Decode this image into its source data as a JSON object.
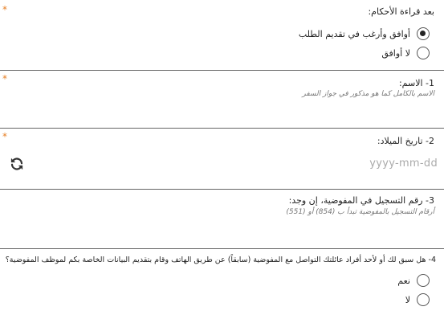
{
  "consent": {
    "question": "بعد قراءة الأحكام:",
    "options": [
      {
        "label": "أوافق وأرغب في تقديم الطلب",
        "selected": true
      },
      {
        "label": "لا أوافق",
        "selected": false
      }
    ]
  },
  "name_field": {
    "label": "1- الاسم:",
    "hint": "الاسم بالكامل كما هو مذكور في جواز السفر"
  },
  "dob_field": {
    "label": "2- تاريخ الميلاد:",
    "placeholder": "yyyy-mm-dd",
    "refresh_icon": "refresh-icon"
  },
  "registration_field": {
    "label": "3- رقم التسجيل في المفوضية، إن وجد:",
    "hint": "أرقام التسجيل بالمفوضية تبدأ ب (854) أو (551)"
  },
  "contact_question": {
    "label": "4- هل سبق لك أو لأحد أفراد عائلتك التواصل مع المفوضية (سابقاً) عن طريق الهاتف وقام بتقديم البيانات الخاصة بكم لموظف المفوضية؟",
    "options": [
      {
        "label": "نعم",
        "selected": false
      },
      {
        "label": "لا",
        "selected": false
      }
    ]
  },
  "required_mark": "*",
  "colors": {
    "required": "#e67e22",
    "divider": "#666666",
    "placeholder": "#aaaaaa"
  }
}
